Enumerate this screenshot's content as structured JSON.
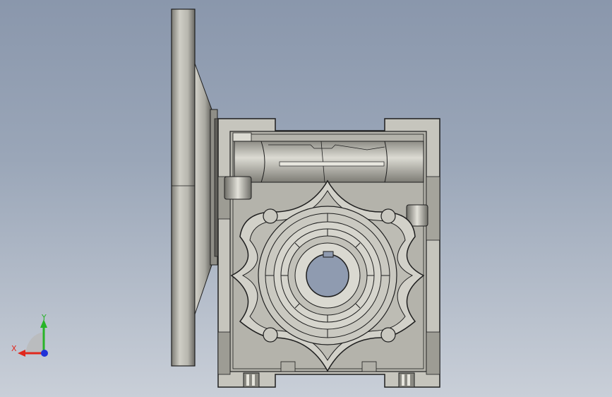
{
  "triad": {
    "x_label": "X",
    "y_label": "Y",
    "x_color": "#e0281e",
    "y_color": "#28b428",
    "z_color": "#2032d8"
  },
  "colors": {
    "background_top": "#8a97ac",
    "background_bottom": "#c9cfd8",
    "body": "#c6c5bd",
    "body_dark": "#6f6e68",
    "shadow": "#4a4a46",
    "edge": "#1e1e1e"
  },
  "model": {
    "type": "worm-gear-reducer",
    "view": "front"
  }
}
